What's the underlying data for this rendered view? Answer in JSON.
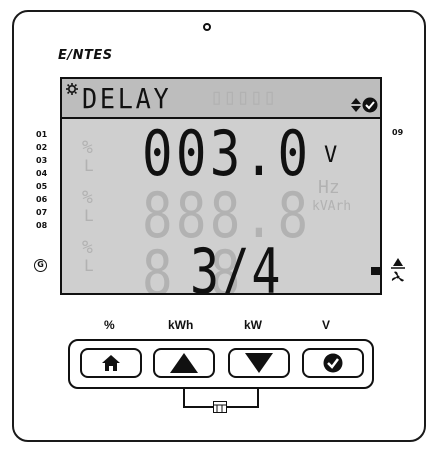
{
  "brand": {
    "name": "E/NTES"
  },
  "lcd": {
    "menu_text": "DELAY",
    "main_value": "003.0",
    "main_unit": "V",
    "bottom_value": "3/4",
    "ghost_percent": "%",
    "ghost_hz": "Hz",
    "ghost_kvarh": "kVArh"
  },
  "side_labels": [
    "01",
    "02",
    "03",
    "04",
    "05",
    "06",
    "07",
    "08"
  ],
  "right_label": "09",
  "g_label": "G",
  "buttons": [
    {
      "label": "%",
      "icon": "home-icon"
    },
    {
      "label": "kWh",
      "icon": "up-triangle-icon"
    },
    {
      "label": "kW",
      "icon": "down-triangle-icon"
    },
    {
      "label": "V",
      "icon": "check-circle-icon"
    }
  ],
  "bracket_icon": "sd-card-icon"
}
